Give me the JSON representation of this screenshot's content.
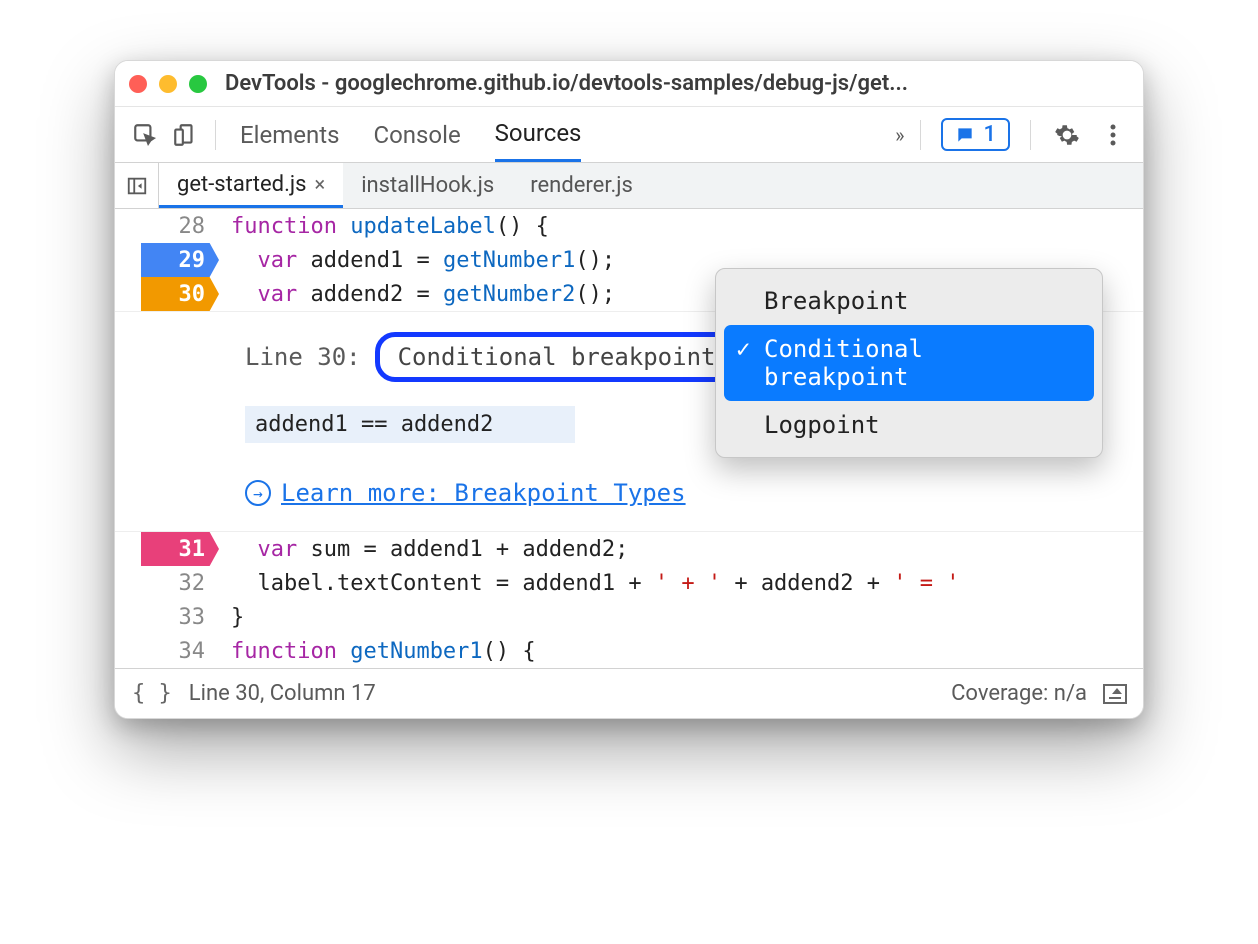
{
  "window": {
    "title": "DevTools - googlechrome.github.io/devtools-samples/debug-js/get..."
  },
  "toolbar": {
    "panels": [
      "Elements",
      "Console",
      "Sources"
    ],
    "active_panel": "Sources",
    "message_count": "1"
  },
  "filetabs": {
    "items": [
      {
        "name": "get-started.js",
        "active": true
      },
      {
        "name": "installHook.js",
        "active": false
      },
      {
        "name": "renderer.js",
        "active": false
      }
    ]
  },
  "code": {
    "lines": [
      {
        "n": "28",
        "bp": null,
        "glyph": "",
        "tokens": [
          [
            "kw",
            "function "
          ],
          [
            "fn",
            "updateLabel"
          ],
          [
            "op",
            "() {"
          ]
        ]
      },
      {
        "n": "29",
        "bp": "blue",
        "glyph": "",
        "tokens": [
          [
            "op",
            "  "
          ],
          [
            "kw",
            "var "
          ],
          [
            "id",
            "addend1"
          ],
          [
            "op",
            " = "
          ],
          [
            "fn",
            "getNumber1"
          ],
          [
            "op",
            "();"
          ]
        ]
      },
      {
        "n": "30",
        "bp": "orange",
        "glyph": "?",
        "tokens": [
          [
            "op",
            "  "
          ],
          [
            "kw",
            "var "
          ],
          [
            "id",
            "addend2"
          ],
          [
            "op",
            " = "
          ],
          [
            "fn",
            "getNumber2"
          ],
          [
            "op",
            "();"
          ]
        ]
      },
      {
        "n": "31",
        "bp": "pink",
        "glyph": "··",
        "tokens": [
          [
            "op",
            "  "
          ],
          [
            "kw",
            "var "
          ],
          [
            "id",
            "sum"
          ],
          [
            "op",
            " = addend1 + addend2;"
          ]
        ]
      },
      {
        "n": "32",
        "bp": null,
        "glyph": "",
        "tokens": [
          [
            "op",
            "  label.textContent = addend1 + "
          ],
          [
            "str",
            "' + '"
          ],
          [
            "op",
            " + addend2 + "
          ],
          [
            "str",
            "' = '"
          ]
        ]
      },
      {
        "n": "33",
        "bp": null,
        "glyph": "",
        "tokens": [
          [
            "op",
            "}"
          ]
        ]
      },
      {
        "n": "34",
        "bp": null,
        "glyph": "",
        "tokens": [
          [
            "kw",
            "function "
          ],
          [
            "fn",
            "getNumber1"
          ],
          [
            "op",
            "() {"
          ]
        ]
      }
    ]
  },
  "bp_editor": {
    "line_label": "Line 30:",
    "type_label": "Conditional breakpoint",
    "expression": "addend1 == addend2",
    "learn_label": "Learn more: Breakpoint Types",
    "dropdown": {
      "items": [
        "Breakpoint",
        "Conditional breakpoint",
        "Logpoint"
      ],
      "selected": "Conditional breakpoint"
    }
  },
  "status": {
    "position": "Line 30, Column 17",
    "coverage": "Coverage: n/a"
  }
}
